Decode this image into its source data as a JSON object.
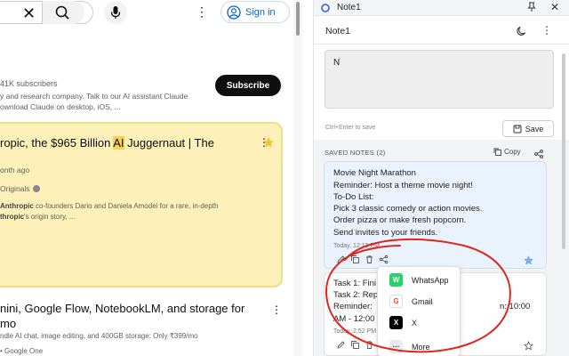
{
  "youtube": {
    "signin_label": "Sign in",
    "subscribers": "41K subscribers",
    "channel_desc_line1": "y and research company. Talk to our AI assistant Claude",
    "channel_desc_line2": "ownload Claude on desktop, iOS, ...",
    "subscribe_label": "Subscribe",
    "card_title_pre": "ropic, the $965 Billion ",
    "card_title_hl": "AI",
    "card_title_post": " Juggernaut | The",
    "card_time": "onth ago",
    "card_channel": "Originals",
    "card_desc_bold": "Anthropic",
    "card_desc_line1_rest": " co-founders Dario and Daniela Amodei for a rare, in-depth",
    "card_desc_line2_bold": "thropic",
    "card_desc_line2_rest": "'s origin story, ...",
    "video2_title_line1": "nini, Google Flow, NotebookLM, and storage for",
    "video2_title_line2": "mo",
    "video2_desc": "ndle AI chat, image editing, and 400GB storage: Only ₹399/mo",
    "video2_source": "• Google One"
  },
  "note_panel": {
    "window_title": "Note1",
    "header_title": "Note1",
    "textarea_value": "N",
    "hint": "Ctrl+Enter to save",
    "save_label": "Save",
    "saved_label": "SAVED NOTES (2)",
    "copy_label": "Copy",
    "notes": [
      {
        "lines": [
          "Movie Night Marathon",
          "Reminder: Host a theme movie night!",
          "To-Do List:",
          "Pick 3 classic comedy or action movies.",
          "Order pizza or make fresh popcorn.",
          "Send invites to your friends."
        ],
        "time": "Today, 12:13 PM"
      },
      {
        "lines": [
          "Task 1: Fini",
          "Task 2: Rep",
          "Reminder:",
          "AM - 12:00"
        ],
        "line3_tail": "n: 10:00",
        "time": "Today, 2:52 PM"
      }
    ],
    "share_menu": [
      {
        "label": "WhatsApp",
        "icon": "whatsapp-icon",
        "color": "#25d366",
        "glyph": "W"
      },
      {
        "label": "Gmail",
        "icon": "gmail-icon",
        "color": "#ea4335",
        "glyph": "G"
      },
      {
        "label": "X",
        "icon": "x-icon",
        "color": "#000000",
        "glyph": "X"
      },
      {
        "label": "More",
        "icon": "more-icon",
        "color": "#e8eaf0",
        "glyph": "···"
      }
    ]
  },
  "colors": {
    "accent_blue": "#065fd4",
    "card_bg": "#fdf0b8",
    "highlight": "#f8cf5a",
    "annotation_red": "#e0251b"
  }
}
